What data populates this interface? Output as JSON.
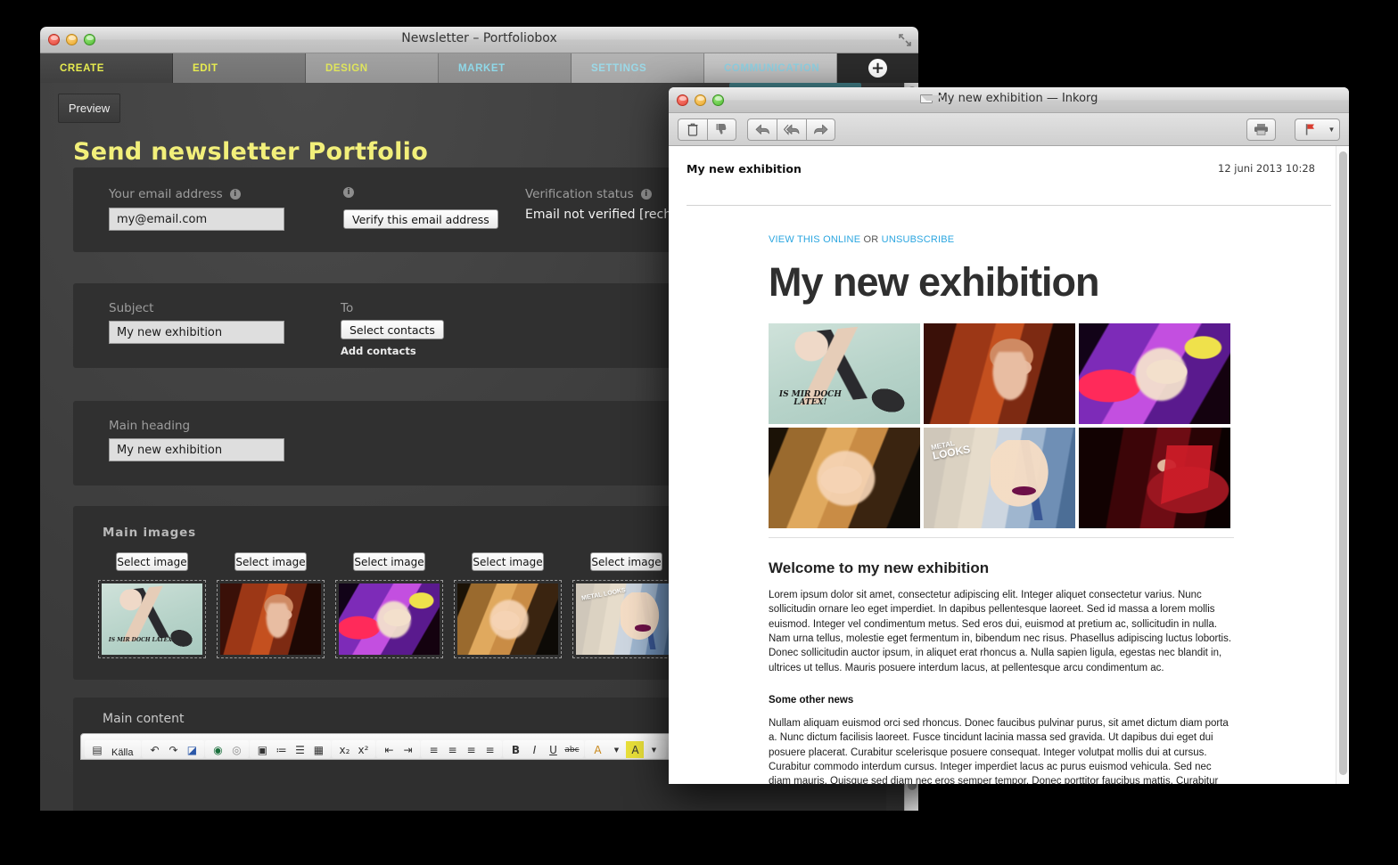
{
  "back_window": {
    "title": "Newsletter – Portfoliobox",
    "window_controls": [
      "close",
      "minimize",
      "zoom"
    ],
    "resize_icon": "resize-icon",
    "tabs": [
      {
        "label": "CREATE",
        "active": true
      },
      {
        "label": "EDIT",
        "active": false
      },
      {
        "label": "DESIGN",
        "active": false
      },
      {
        "label": "MARKET",
        "active": false
      },
      {
        "label": "SETTINGS",
        "active": false
      },
      {
        "label": "COMMUNICATION",
        "active": false
      }
    ],
    "add_tab_label": "+",
    "preview_button": "Preview",
    "page_title": "Send newsletter Portfolio",
    "email_section": {
      "email_label": "Your email address",
      "email_value": "my@email.com",
      "verify_button": "Verify this email address",
      "verification_label": "Verification status",
      "verification_status": "Email not verified [recheck]"
    },
    "subject_section": {
      "subject_label": "Subject",
      "subject_value": "My new exhibition",
      "to_label": "To",
      "select_contacts_button": "Select contacts",
      "add_contacts_link": "Add contacts"
    },
    "heading_section": {
      "heading_label": "Main heading",
      "heading_value": "My new exhibition"
    },
    "images_section": {
      "section_label": "Main images",
      "select_image_label": "Select image",
      "thumbnails": [
        {
          "name": "thumb-latex",
          "caption": "IS MIR DOCH LATEX!"
        },
        {
          "name": "thumb-redhair",
          "caption": ""
        },
        {
          "name": "thumb-purple",
          "caption": ""
        },
        {
          "name": "thumb-blonde",
          "caption": ""
        },
        {
          "name": "thumb-metal",
          "caption": "METAL LOOKS"
        }
      ]
    },
    "content_section": {
      "section_label": "Main content",
      "editor_source_button": "Källa"
    }
  },
  "mail_window": {
    "title": "My new exhibition — Inkorg",
    "window_controls": [
      "close",
      "minimize",
      "zoom"
    ],
    "toolbar": {
      "delete": "delete-icon",
      "junk": "junk-icon",
      "reply": "reply-icon",
      "reply_all": "reply-all-icon",
      "forward": "forward-icon",
      "print": "print-icon",
      "flag": "flag-icon",
      "flag_dropdown": "chevron-down-icon"
    },
    "message": {
      "subject": "My new exhibition",
      "date": "12 juni 2013 10:28"
    },
    "newsletter": {
      "view_online_link": "VIEW THIS ONLINE",
      "or_text": " OR ",
      "unsubscribe_link": "UNSUBSCRIBE",
      "headline": "My new exhibition",
      "images": [
        {
          "name": "image-latex",
          "caption_line1": "IS MIR DOCH",
          "caption_line2": "LATEX!"
        },
        {
          "name": "image-redhair",
          "caption_line1": "",
          "caption_line2": ""
        },
        {
          "name": "image-purple",
          "caption_line1": "",
          "caption_line2": ""
        },
        {
          "name": "image-blonde",
          "caption_line1": "",
          "caption_line2": ""
        },
        {
          "name": "image-metal",
          "caption_line1": "METAL",
          "caption_line2": "LOOKS"
        },
        {
          "name": "image-reddress",
          "caption_line1": "",
          "caption_line2": ""
        }
      ],
      "welcome_heading": "Welcome to my new exhibition",
      "welcome_paragraph": "Lorem ipsum dolor sit amet, consectetur adipiscing elit. Integer aliquet consectetur varius. Nunc sollicitudin ornare leo eget imperdiet. In dapibus pellentesque laoreet. Sed id massa a lorem mollis euismod. Integer vel condimentum metus. Sed eros dui, euismod at pretium ac, sollicitudin in nulla. Nam urna tellus, molestie eget fermentum in, bibendum nec risus. Phasellus adipiscing luctus lobortis. Donec sollicitudin auctor ipsum, in aliquet erat rhoncus a. Nulla sapien ligula, egestas nec blandit in, ultrices ut tellus. Mauris posuere interdum lacus, at pellentesque arcu condimentum ac.",
      "other_news_heading": "Some other news",
      "other_news_paragraph": "Nullam aliquam euismod orci sed rhoncus. Donec faucibus pulvinar purus, sit amet dictum diam porta a. Nunc dictum facilisis laoreet. Fusce tincidunt lacinia massa sed gravida. Ut dapibus dui eget dui posuere placerat. Curabitur scelerisque posuere consequat. Integer volutpat mollis dui at cursus. Curabitur commodo interdum cursus. Integer imperdiet lacus ac purus euismod vehicula. Sed nec diam mauris. Quisque sed diam nec eros semper tempor. Donec porttitor faucibus mattis. Curabitur eget nisi at metus ornare condimentum. Nulla vitae ultrices orci."
    }
  },
  "colors": {
    "accent_yellow": "#f2ef7a",
    "accent_cyan": "#8fd8e8",
    "link_blue": "#2ba6e0",
    "panel_dark": "#303030",
    "teal_bar": "#3f7b84"
  }
}
